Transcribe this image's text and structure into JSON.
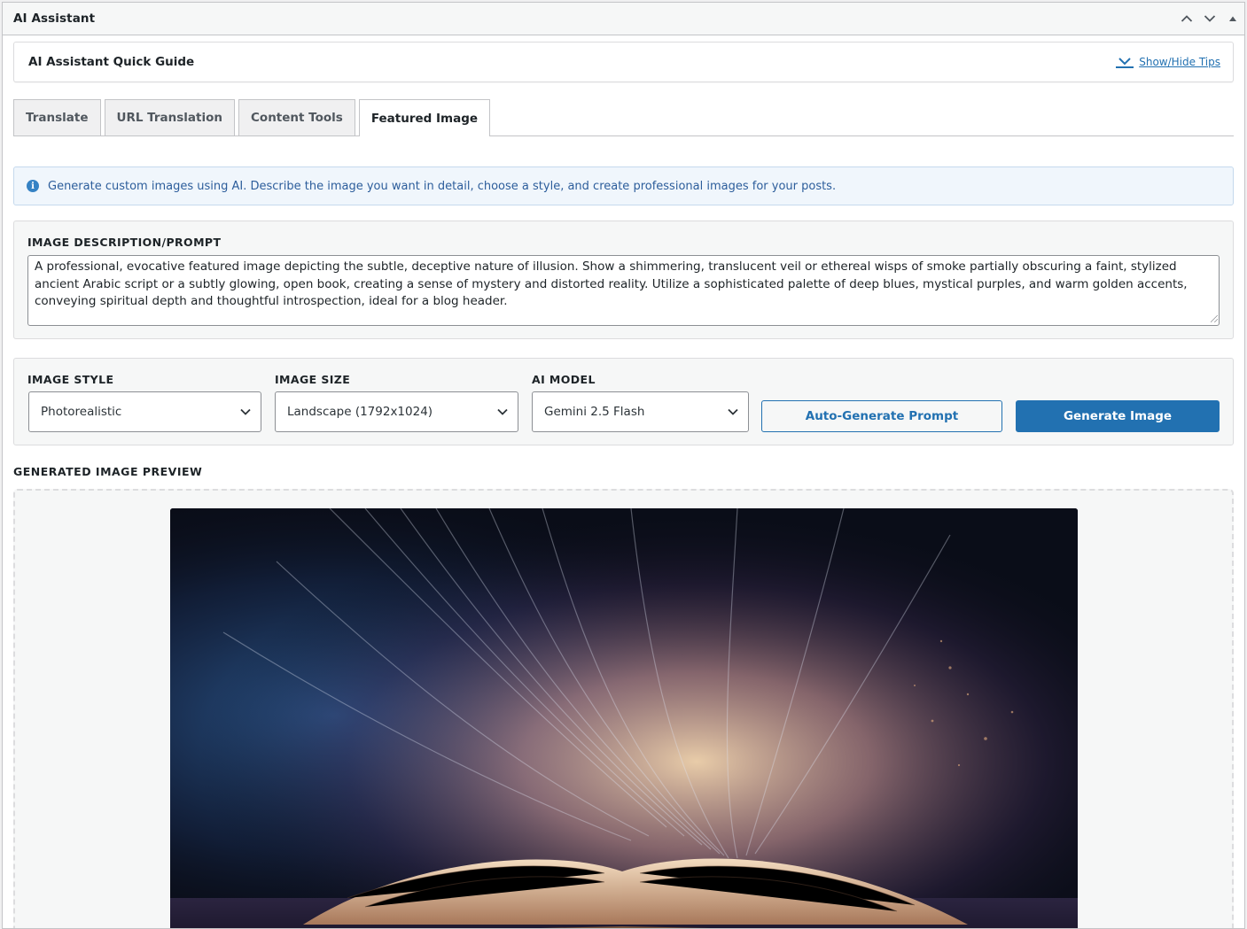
{
  "metabox": {
    "title": "AI Assistant",
    "controls": [
      "chevron-up-icon",
      "chevron-down-icon",
      "triangle-up-icon"
    ]
  },
  "guide": {
    "title": "AI Assistant Quick Guide",
    "toggle_label": "Show/Hide Tips"
  },
  "tabs": [
    {
      "label": "Translate",
      "active": false
    },
    {
      "label": "URL Translation",
      "active": false
    },
    {
      "label": "Content Tools",
      "active": false
    },
    {
      "label": "Featured Image",
      "active": true
    }
  ],
  "notice": {
    "icon": "info-icon",
    "text": "Generate custom images using AI. Describe the image you want in detail, choose a style, and create professional images for your posts."
  },
  "prompt": {
    "label": "IMAGE DESCRIPTION/PROMPT",
    "value": "A professional, evocative featured image depicting the subtle, deceptive nature of illusion. Show a shimmering, translucent veil or ethereal wisps of smoke partially obscuring a faint, stylized ancient Arabic script or a subtly glowing, open book, creating a sense of mystery and distorted reality. Utilize a sophisticated palette of deep blues, mystical purples, and warm golden accents, conveying spiritual depth and thoughtful introspection, ideal for a blog header."
  },
  "controls": {
    "style": {
      "label": "IMAGE STYLE",
      "value": "Photorealistic"
    },
    "size": {
      "label": "IMAGE SIZE",
      "value": "Landscape (1792x1024)"
    },
    "model": {
      "label": "AI MODEL",
      "value": "Gemini 2.5 Flash"
    },
    "auto_prompt_label": "Auto-Generate Prompt",
    "generate_label": "Generate Image"
  },
  "preview": {
    "label": "GENERATED IMAGE PREVIEW"
  },
  "colors": {
    "primary": "#2271b1",
    "notice_bg": "#f0f6fc",
    "notice_text": "#2c5d9b"
  }
}
